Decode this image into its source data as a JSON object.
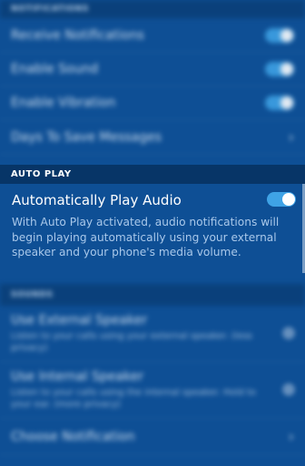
{
  "notifications": {
    "header": "NOTIFICATIONS",
    "items": [
      {
        "label": "Receive Notifications",
        "control": "toggle"
      },
      {
        "label": "Enable Sound",
        "control": "toggle"
      },
      {
        "label": "Enable Vibration",
        "control": "toggle"
      },
      {
        "label": "Days To Save Messages",
        "control": "chevron"
      }
    ]
  },
  "auto_play": {
    "header": "AUTO PLAY",
    "title": "Automatically Play Audio",
    "toggle_on": true,
    "description": "With Auto Play activated, audio notifications will begin playing automatically using your external speaker and your phone's media volume."
  },
  "sounds": {
    "header": "SOUNDS",
    "items": [
      {
        "label": "Use External Speaker",
        "sub": "Listen to your calls using your external speaker. (less privacy)"
      },
      {
        "label": "Use Internal Speaker",
        "sub": "Listen to your calls using the internal speaker. Hold to your ear. (more privacy)"
      },
      {
        "label": "Choose Notification"
      }
    ]
  },
  "colors": {
    "background": "#0e4f95",
    "header": "#073567",
    "toggle": "#3fa3e6",
    "description": "#a9c8ea"
  }
}
